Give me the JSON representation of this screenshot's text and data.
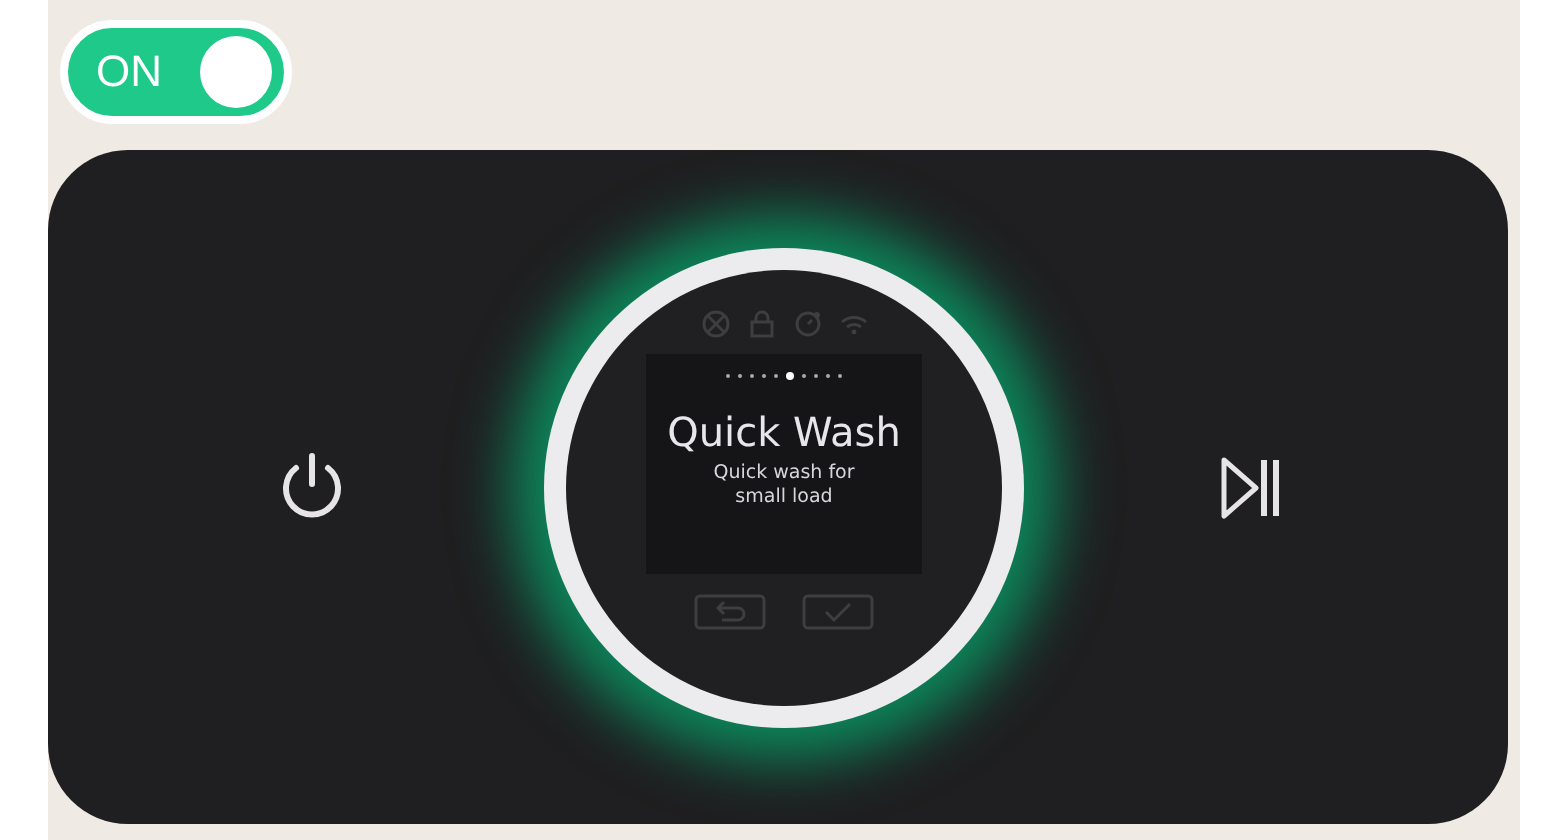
{
  "power_toggle": {
    "label": "ON",
    "on": true
  },
  "display": {
    "title": "Quick Wash",
    "description": "Quick wash for small load",
    "page_dots": [
      {
        "selected": false
      },
      {
        "selected": false
      },
      {
        "selected": false
      },
      {
        "selected": false
      },
      {
        "selected": false
      },
      {
        "selected": true
      },
      {
        "selected": false
      },
      {
        "selected": false
      },
      {
        "selected": false
      },
      {
        "selected": false
      }
    ]
  }
}
